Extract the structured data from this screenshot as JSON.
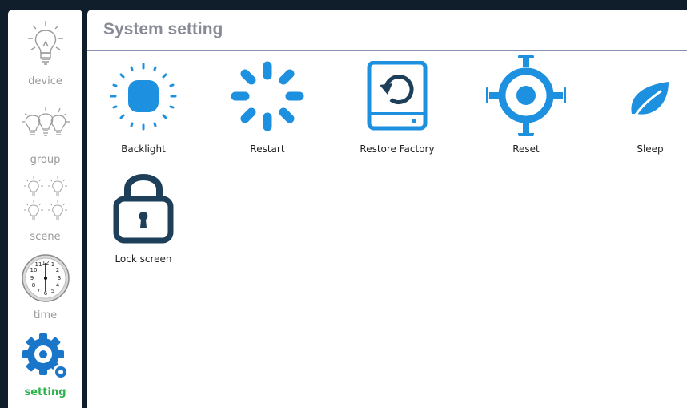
{
  "sidebar": {
    "items": [
      {
        "label": "device",
        "icon": "bulb-icon"
      },
      {
        "label": "group",
        "icon": "bulb-group-icon"
      },
      {
        "label": "scene",
        "icon": "scene-bulbs-icon"
      },
      {
        "label": "time",
        "icon": "clock-icon"
      },
      {
        "label": "setting",
        "icon": "gear-icon"
      }
    ],
    "active": "setting"
  },
  "header": {
    "title": "System setting"
  },
  "settings": [
    {
      "label": "Backlight",
      "icon": "backlight-icon"
    },
    {
      "label": "Restart",
      "icon": "restart-spinner-icon"
    },
    {
      "label": "Restore Factory",
      "icon": "restore-drive-icon"
    },
    {
      "label": "Reset",
      "icon": "crosshair-icon"
    },
    {
      "label": "Sleep",
      "icon": "leaf-icon"
    },
    {
      "label": "Lock screen",
      "icon": "padlock-icon"
    }
  ],
  "colors": {
    "accent": "#1e90e0",
    "dark_icon": "#1e3f5a",
    "active_label": "#2bb24c",
    "frame": "#0f1e2a"
  }
}
